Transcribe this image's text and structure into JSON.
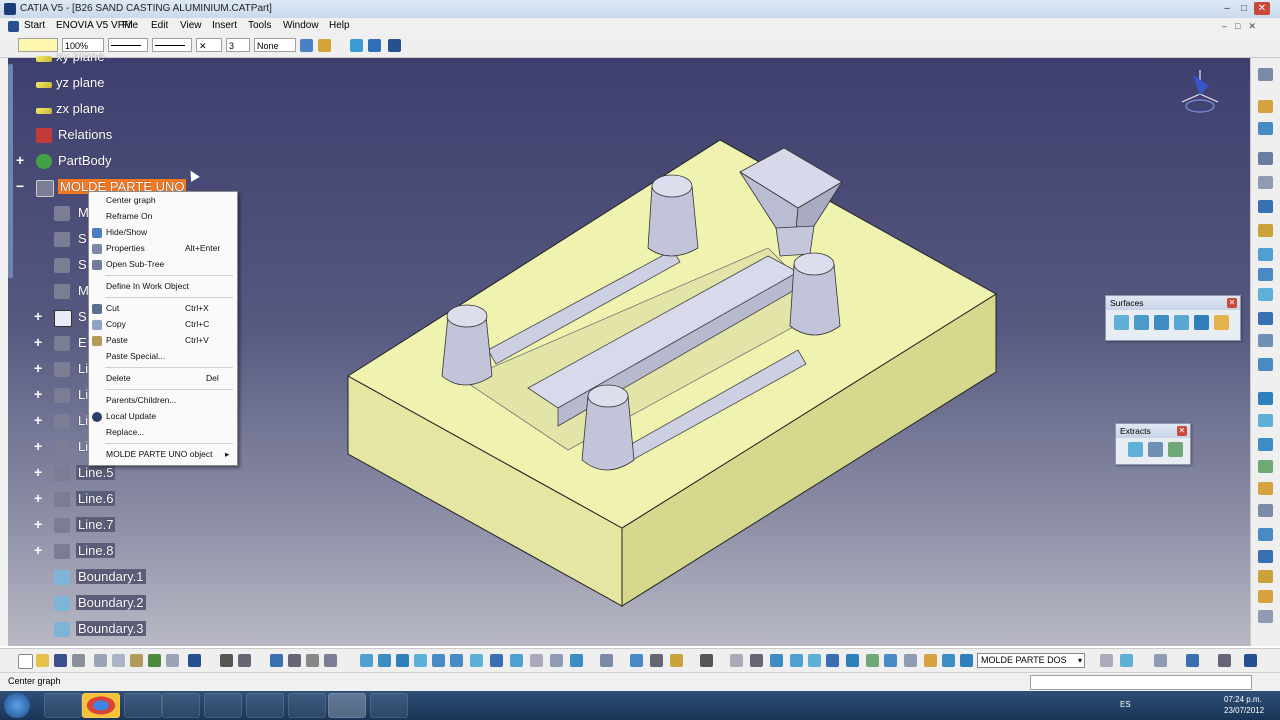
{
  "window": {
    "title": "CATIA V5 - [B26 SAND CASTING ALUMINIUM.CATPart]",
    "min": "–",
    "max": "□",
    "close": "✕"
  },
  "menu": [
    "Start",
    "ENOVIA V5 VPM",
    "File",
    "Edit",
    "View",
    "Insert",
    "Tools",
    "Window",
    "Help"
  ],
  "toolbar": {
    "zoom": "100%",
    "layer": "None",
    "weight": "3"
  },
  "tree": {
    "items": [
      {
        "label": "xy plane"
      },
      {
        "label": "yz plane"
      },
      {
        "label": "zx plane"
      },
      {
        "label": "Relations"
      },
      {
        "label": "PartBody"
      },
      {
        "label": "MOLDE PARTE UNO",
        "selected": true
      },
      {
        "label": "M"
      },
      {
        "label": "S"
      },
      {
        "label": "S"
      },
      {
        "label": "M"
      },
      {
        "label": "S"
      },
      {
        "label": "E"
      },
      {
        "label": "Li"
      },
      {
        "label": "Li"
      },
      {
        "label": "Li"
      },
      {
        "label": "Li"
      },
      {
        "label": "Line.5"
      },
      {
        "label": "Line.6"
      },
      {
        "label": "Line.7"
      },
      {
        "label": "Line.8"
      },
      {
        "label": "Boundary.1"
      },
      {
        "label": "Boundary.2"
      },
      {
        "label": "Boundary.3"
      }
    ]
  },
  "context_menu": {
    "items": [
      {
        "label": "Center graph",
        "shortcut": ""
      },
      {
        "label": "Reframe On",
        "shortcut": ""
      },
      {
        "label": "Hide/Show",
        "shortcut": ""
      },
      {
        "label": "Properties",
        "shortcut": "Alt+Enter"
      },
      {
        "label": "Open Sub-Tree",
        "shortcut": ""
      },
      {
        "label": "Define In Work Object",
        "shortcut": ""
      },
      {
        "label": "Cut",
        "shortcut": "Ctrl+X"
      },
      {
        "label": "Copy",
        "shortcut": "Ctrl+C"
      },
      {
        "label": "Paste",
        "shortcut": "Ctrl+V"
      },
      {
        "label": "Paste Special...",
        "shortcut": ""
      },
      {
        "label": "Delete",
        "shortcut": "Del"
      },
      {
        "label": "Parents/Children...",
        "shortcut": ""
      },
      {
        "label": "Local Update",
        "shortcut": ""
      },
      {
        "label": "Replace...",
        "shortcut": ""
      },
      {
        "label": "MOLDE PARTE UNO object",
        "shortcut": "▸"
      }
    ]
  },
  "floating_toolbars": {
    "surfaces": {
      "title": "Surfaces"
    },
    "extracts": {
      "title": "Extracts"
    }
  },
  "bottom": {
    "work_object": "MOLDE PARTE DOS"
  },
  "status": {
    "text": "Center graph"
  },
  "taskbar": {
    "lang": "ES",
    "time": "07:24 p.m.",
    "date": "23/07/2012"
  },
  "colors": {
    "mold_top": "#f0f2b0",
    "mold_side_front": "#e4e6a2",
    "mold_side_right": "#d6d88e",
    "cast_part": "#c9cbdd",
    "selection": "#f47a22"
  }
}
